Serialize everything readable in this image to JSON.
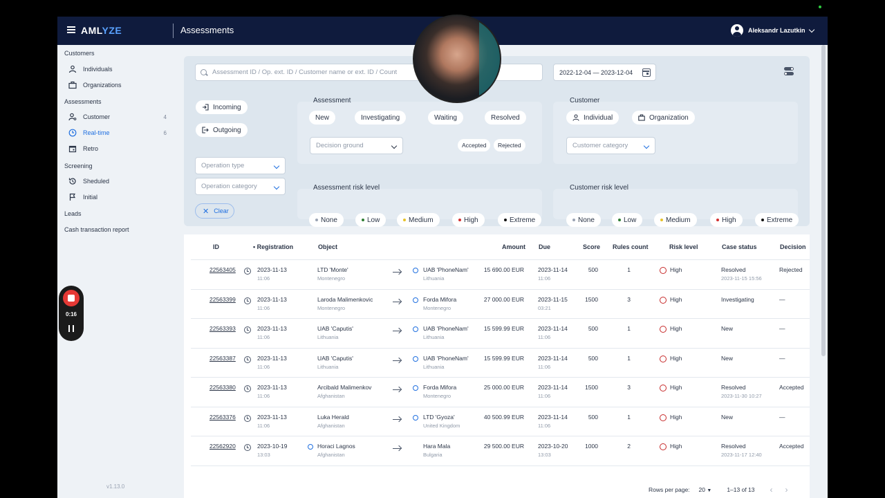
{
  "app": {
    "logo_a": "AML",
    "logo_b": "YZE",
    "page_title": "Assessments",
    "version": "v1.13.0"
  },
  "user": {
    "name": "Aleksandr Lazutkin"
  },
  "sidebar": {
    "customers_section": "Customers",
    "customers": [
      {
        "label": "Individuals",
        "icon": "person-icon"
      },
      {
        "label": "Organizations",
        "icon": "briefcase-icon"
      }
    ],
    "assessments_section": "Assessments",
    "assessments": [
      {
        "label": "Customer",
        "count": "4",
        "icon": "person-search-icon"
      },
      {
        "label": "Real-time",
        "count": "6",
        "icon": "clock-icon",
        "active": true
      },
      {
        "label": "Retro",
        "icon": "calendar-icon"
      }
    ],
    "screening_section": "Screening",
    "screening": [
      {
        "label": "Sheduled",
        "icon": "history-icon"
      },
      {
        "label": "Initial",
        "icon": "flag-icon"
      }
    ],
    "leads": "Leads",
    "cash_report": "Cash transaction report"
  },
  "filters": {
    "search_placeholder": "Assessment ID / Op. ext. ID / Customer name or ext. ID / Count",
    "date_range": "2022-12-04 — 2023-12-04",
    "incoming": "Incoming",
    "outgoing": "Outgoing",
    "operation_type": "Operation type",
    "operation_category": "Operation category",
    "clear": "Clear",
    "assessment_label": "Assessment",
    "assessment_states": [
      "New",
      "Investigating",
      "Waiting",
      "Resolved"
    ],
    "decision_ground": "Decision ground",
    "accepted": "Accepted",
    "rejected": "Rejected",
    "customer_label": "Customer",
    "individual": "Individual",
    "organization": "Organization",
    "customer_category": "Customer category",
    "assessment_risk_label": "Assessment risk level",
    "customer_risk_label": "Customer risk level",
    "risk_levels": [
      {
        "label": "None",
        "color": "#9aa3b3"
      },
      {
        "label": "Low",
        "color": "#2e7d32"
      },
      {
        "label": "Medium",
        "color": "#e6c229"
      },
      {
        "label": "High",
        "color": "#d32f2f"
      },
      {
        "label": "Extreme",
        "color": "#111111"
      }
    ]
  },
  "table": {
    "headers": {
      "id": "ID",
      "registration": "Registration",
      "object": "Object",
      "amount": "Amount",
      "due": "Due",
      "score": "Score",
      "rules": "Rules count",
      "risk": "Risk level",
      "status": "Case status",
      "decision": "Decision"
    },
    "rows": [
      {
        "id": "22563405",
        "reg_date": "2023-11-13",
        "reg_time": "11:06",
        "from_name": "LTD 'Monte'",
        "from_country": "Montenegro",
        "to_name": "UAB 'PhoneNam'",
        "to_country": "Lithuania",
        "amount": "15 690.00 EUR",
        "due_date": "2023-11-14",
        "due_time": "11:06",
        "score": "500",
        "rules": "1",
        "risk": "High",
        "status": "Resolved",
        "status_date": "2023-11-15 15:56",
        "decision": "Rejected"
      },
      {
        "id": "22563399",
        "reg_date": "2023-11-13",
        "reg_time": "11:06",
        "from_name": "Laroda Malimenkovic",
        "from_country": "Montenegro",
        "to_name": "Forda Mifora",
        "to_country": "Montenegro",
        "amount": "27 000.00 EUR",
        "due_date": "2023-11-15",
        "due_time": "03:21",
        "score": "1500",
        "rules": "3",
        "risk": "High",
        "status": "Investigating",
        "status_date": "",
        "decision": "—"
      },
      {
        "id": "22563393",
        "reg_date": "2023-11-13",
        "reg_time": "11:06",
        "from_name": "UAB 'Caputis'",
        "from_country": "Lithuania",
        "to_name": "UAB 'PhoneNam'",
        "to_country": "Lithuania",
        "amount": "15 599.99 EUR",
        "due_date": "2023-11-14",
        "due_time": "11:06",
        "score": "500",
        "rules": "1",
        "risk": "High",
        "status": "New",
        "status_date": "",
        "decision": "—"
      },
      {
        "id": "22563387",
        "reg_date": "2023-11-13",
        "reg_time": "11:06",
        "from_name": "UAB 'Caputis'",
        "from_country": "Lithuania",
        "to_name": "UAB 'PhoneNam'",
        "to_country": "Lithuania",
        "amount": "15 599.99 EUR",
        "due_date": "2023-11-14",
        "due_time": "11:06",
        "score": "500",
        "rules": "1",
        "risk": "High",
        "status": "New",
        "status_date": "",
        "decision": "—"
      },
      {
        "id": "22563380",
        "reg_date": "2023-11-13",
        "reg_time": "11:06",
        "from_name": "Arcibald Malimenkov",
        "from_country": "Afghanistan",
        "to_name": "Forda Mifora",
        "to_country": "Montenegro",
        "amount": "25 000.00 EUR",
        "due_date": "2023-11-14",
        "due_time": "11:06",
        "score": "1500",
        "rules": "3",
        "risk": "High",
        "status": "Resolved",
        "status_date": "2023-11-30 10:27",
        "decision": "Accepted"
      },
      {
        "id": "22563376",
        "reg_date": "2023-11-13",
        "reg_time": "11:06",
        "from_name": "Luka Herald",
        "from_country": "Afghanistan",
        "to_name": "LTD 'Gyoza'",
        "to_country": "United Kingdom",
        "amount": "40 500.99 EUR",
        "due_date": "2023-11-14",
        "due_time": "11:06",
        "score": "500",
        "rules": "1",
        "risk": "High",
        "status": "New",
        "status_date": "",
        "decision": "—"
      },
      {
        "id": "22562920",
        "reg_date": "2023-10-19",
        "reg_time": "13:03",
        "from_name": "Horaci Lagnos",
        "from_country": "Afghanistan",
        "to_name": "Hara Mala",
        "to_country": "Bulgaria",
        "amount": "29 500.00 EUR",
        "due_date": "2023-10-20",
        "due_time": "13:03",
        "score": "1000",
        "rules": "2",
        "risk": "High",
        "status": "Resolved",
        "status_date": "2023-11-17 12:40",
        "decision": "Accepted"
      }
    ],
    "rows_per_page_label": "Rows per page:",
    "rows_per_page": "20",
    "range": "1–13 of 13"
  },
  "recording": {
    "time": "0:16"
  }
}
